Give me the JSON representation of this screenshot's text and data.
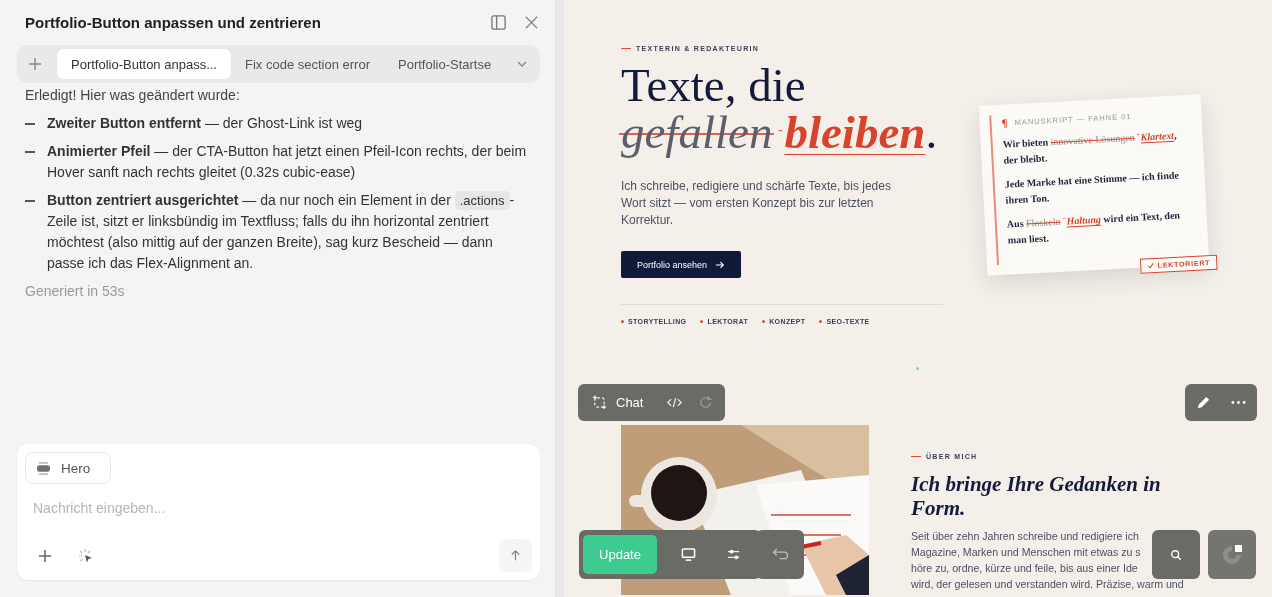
{
  "chat_panel": {
    "title": "Portfolio-Button anpassen und zentrieren",
    "tabs": [
      {
        "label": "Portfolio-Button anpass...",
        "selected": true
      },
      {
        "label": "Fix code section error",
        "selected": false
      },
      {
        "label": "Portfolio-Startse",
        "selected": false
      }
    ],
    "message": {
      "intro": "Erledigt! Hier was geändert wurde:",
      "items": [
        [
          {
            "kind": "text",
            "text": "**Zweiter Button entfernt** — der Ghost-Link ist weg"
          }
        ],
        [
          {
            "kind": "text",
            "text": "**Animierter Pfeil** — der CTA-Button hat jetzt einen Pfeil-Icon rechts, der beim Hover sanft nach rechts gleitet (0.32s cubic-ease)"
          }
        ],
        [
          {
            "kind": "text",
            "text": "**Button zentriert ausgerichtet** — da nur noch ein Element in der "
          },
          {
            "kind": "code",
            "text": ".actions"
          },
          {
            "kind": "text",
            "text": "-Zeile ist, sitzt er linksbündig im Textfluss; falls du ihn horizontal zentriert möchtest (also mittig auf der ganzen Breite), sag kurz Bescheid — dann passe ich das Flex-Alignment an."
          }
        ]
      ],
      "footer": "Generiert in 53s"
    },
    "composer": {
      "context_chip": "Hero",
      "placeholder": "Nachricht eingeben..."
    }
  },
  "preview": {
    "hero": {
      "eyebrow": "TEXTERIN & REDAKTEURIN",
      "headline": [
        [
          {
            "kind": "plain",
            "text": "Texte, die"
          }
        ],
        [
          {
            "kind": "deleted",
            "text": "gefallen"
          },
          {
            "kind": "inserted",
            "text": "bleiben"
          },
          {
            "kind": "plain",
            "text": "."
          }
        ]
      ],
      "lead": "Ich schreibe, redigiere und schärfe Texte, bis jedes Wort sitzt — vom ersten Konzept bis zur letzten Korrektur.",
      "cta": "Portfolio ansehen",
      "tags": [
        "STORYTELLING",
        "LEKTORAT",
        "KONZEPT",
        "SEO-TEXTE"
      ]
    },
    "manuscript_card": {
      "pilcrow": "¶",
      "label": "MANUSKRIPT — FAHNE 01",
      "paragraphs": [
        [
          {
            "kind": "plain",
            "text": "Wir bieten "
          },
          {
            "kind": "deleted",
            "text": "innovative Lösungen"
          },
          {
            "kind": "inserted",
            "text": "Klartext"
          },
          {
            "kind": "plain",
            "text": ", der bleibt."
          }
        ],
        [
          {
            "kind": "plain",
            "text": "Jede Marke hat eine Stimme — ich finde ihren Ton."
          }
        ],
        [
          {
            "kind": "plain",
            "text": "Aus "
          },
          {
            "kind": "deleted",
            "text": "Floskeln"
          },
          {
            "kind": "inserted",
            "text": "Haltung"
          },
          {
            "kind": "plain",
            "text": " wird ein Text, den man liest."
          }
        ]
      ],
      "stamp": "LEKTORIERT"
    },
    "about": {
      "eyebrow": "ÜBER MICH",
      "heading": "Ich bringe Ihre Gedanken in Form.",
      "body_lines": [
        "Seit über zehn Jahren schreibe und redigiere ich",
        "Magazine, Marken und Menschen mit etwas zu s",
        "höre zu, ordne, kürze und feile, bis aus einer Ide",
        "wird, der gelesen und verstanden wird. Präzise, warm und"
      ]
    },
    "toolbar": {
      "chat_label": "Chat",
      "update_label": "Update"
    }
  }
}
